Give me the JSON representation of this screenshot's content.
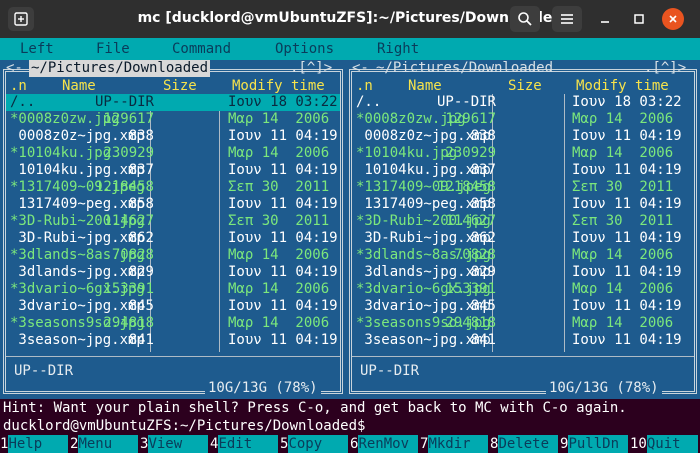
{
  "window": {
    "title": "mc [ducklord@vmUbuntuZFS]:~/Pictures/Downloaded",
    "colors": {
      "panel_bg": "#1e5b8e",
      "accent": "#00aab0",
      "exec": "#7ce87c",
      "header": "#f7e34b",
      "close": "#e95420"
    }
  },
  "menu": [
    "Left",
    "File",
    "Command",
    "Options",
    "Right"
  ],
  "panels": [
    {
      "path": "~/Pictures/Downloaded",
      "corner": ".[^]>",
      "left_mark": "<-",
      "headers": {
        "name_col": ".n",
        "name": "Name",
        "size": "Size",
        "time": "Modify time"
      },
      "rows": [
        {
          "name": "/..",
          "size": "UP--DIR",
          "date": "Ιουν 18 03:22",
          "type": "dir",
          "selected": true
        },
        {
          "name": "*0008z0zw.jpg",
          "size": "129617",
          "date": "Μαρ 14  2006",
          "type": "exec"
        },
        {
          "name": " 0008z0z~jpg.xmp",
          "size": "838",
          "date": "Ιουν 11 04:19",
          "type": "file"
        },
        {
          "name": "*10104ku.jpg",
          "size": "230929",
          "date": "Μαρ 14  2006",
          "type": "exec"
        },
        {
          "name": " 10104ku.jpg.xmp",
          "size": "837",
          "date": "Ιουν 11 04:19",
          "type": "file"
        },
        {
          "name": "*1317409~09.jpeg",
          "size": "1218458",
          "date": "Σεπ 30  2011",
          "type": "exec"
        },
        {
          "name": " 1317409~peg.xmp",
          "size": "858",
          "date": "Ιουν 11 04:19",
          "type": "file"
        },
        {
          "name": "*3D-Rubi~200.jpg",
          "size": "114627",
          "date": "Σεπ 30  2011",
          "type": "exec"
        },
        {
          "name": " 3D-Rubi~jpg.xmp",
          "size": "862",
          "date": "Ιουν 11 04:19",
          "type": "file"
        },
        {
          "name": "*3dlands~8as.jpg",
          "size": "70828",
          "date": "Μαρ 14  2006",
          "type": "exec"
        },
        {
          "name": " 3dlands~jpg.xmp",
          "size": "829",
          "date": "Ιουν 11 04:19",
          "type": "file"
        },
        {
          "name": "*3dvario~6gx.jpg",
          "size": "153391",
          "date": "Μαρ 14  2006",
          "type": "exec"
        },
        {
          "name": " 3dvario~jpg.xmp",
          "size": "845",
          "date": "Ιουν 11 04:19",
          "type": "file"
        },
        {
          "name": "*3seasons9so.jpg",
          "size": "294818",
          "date": "Μαρ 14  2006",
          "type": "exec"
        },
        {
          "name": " 3season~jpg.xmp",
          "size": "841",
          "date": "Ιουν 11 04:19",
          "type": "file"
        }
      ],
      "status": "UP--DIR",
      "free": "10G/13G (78%)"
    },
    {
      "path": "~/Pictures/Downloaded",
      "corner": ".[^]>",
      "left_mark": "<-",
      "headers": {
        "name_col": ".n",
        "name": "Name",
        "size": "Size",
        "time": "Modify time"
      },
      "rows": [
        {
          "name": "/..",
          "size": "UP--DIR",
          "date": "Ιουν 18 03:22",
          "type": "dir"
        },
        {
          "name": "*0008z0zw.jpg",
          "size": "129617",
          "date": "Μαρ 14  2006",
          "type": "exec"
        },
        {
          "name": " 0008z0z~jpg.xmp",
          "size": "838",
          "date": "Ιουν 11 04:19",
          "type": "file"
        },
        {
          "name": "*10104ku.jpg",
          "size": "230929",
          "date": "Μαρ 14  2006",
          "type": "exec"
        },
        {
          "name": " 10104ku.jpg.xmp",
          "size": "837",
          "date": "Ιουν 11 04:19",
          "type": "file"
        },
        {
          "name": "*1317409~09.jpeg",
          "size": "1218458",
          "date": "Σεπ 30  2011",
          "type": "exec"
        },
        {
          "name": " 1317409~peg.xmp",
          "size": "858",
          "date": "Ιουν 11 04:19",
          "type": "file"
        },
        {
          "name": "*3D-Rubi~200.jpg",
          "size": "114627",
          "date": "Σεπ 30  2011",
          "type": "exec"
        },
        {
          "name": " 3D-Rubi~jpg.xmp",
          "size": "862",
          "date": "Ιουν 11 04:19",
          "type": "file"
        },
        {
          "name": "*3dlands~8as.jpg",
          "size": "70828",
          "date": "Μαρ 14  2006",
          "type": "exec"
        },
        {
          "name": " 3dlands~jpg.xmp",
          "size": "829",
          "date": "Ιουν 11 04:19",
          "type": "file"
        },
        {
          "name": "*3dvario~6gx.jpg",
          "size": "153391",
          "date": "Μαρ 14  2006",
          "type": "exec"
        },
        {
          "name": " 3dvario~jpg.xmp",
          "size": "845",
          "date": "Ιουν 11 04:19",
          "type": "file"
        },
        {
          "name": "*3seasons9so.jpg",
          "size": "294818",
          "date": "Μαρ 14  2006",
          "type": "exec"
        },
        {
          "name": " 3season~jpg.xmp",
          "size": "841",
          "date": "Ιουν 11 04:19",
          "type": "file"
        }
      ],
      "status": "UP--DIR",
      "free": "10G/13G (78%)"
    }
  ],
  "hint": "Hint: Want your plain shell? Press C-o, and get back to MC with C-o again.",
  "prompt": "ducklord@vmUbuntuZFS:~/Pictures/Downloaded$",
  "fkeys": [
    {
      "n": "1",
      "label": "Help"
    },
    {
      "n": "2",
      "label": "Menu"
    },
    {
      "n": "3",
      "label": "View"
    },
    {
      "n": "4",
      "label": "Edit"
    },
    {
      "n": "5",
      "label": "Copy"
    },
    {
      "n": "6",
      "label": "RenMov"
    },
    {
      "n": "7",
      "label": "Mkdir"
    },
    {
      "n": "8",
      "label": "Delete"
    },
    {
      "n": "9",
      "label": "PullDn"
    },
    {
      "n": "10",
      "label": "Quit"
    }
  ]
}
